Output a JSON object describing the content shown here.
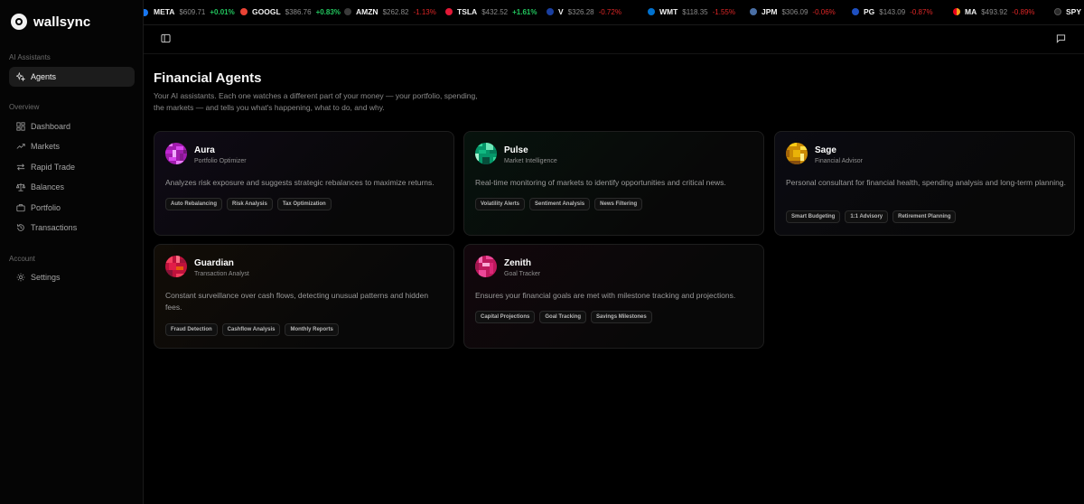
{
  "brand": {
    "name": "wallsync"
  },
  "sidebar": {
    "sections": [
      {
        "label": "AI Assistants"
      },
      {
        "label": "Overview"
      },
      {
        "label": "Account"
      }
    ],
    "items": [
      {
        "label": "Agents",
        "icon": "sparkles-icon",
        "active": true
      },
      {
        "label": "Dashboard",
        "icon": "grid-icon"
      },
      {
        "label": "Markets",
        "icon": "trending-icon"
      },
      {
        "label": "Rapid Trade",
        "icon": "arrows-icon"
      },
      {
        "label": "Balances",
        "icon": "scale-icon"
      },
      {
        "label": "Portfolio",
        "icon": "briefcase-icon"
      },
      {
        "label": "Transactions",
        "icon": "history-icon"
      },
      {
        "label": "Settings",
        "icon": "gear-icon"
      }
    ]
  },
  "ticker": [
    {
      "symbol": "META",
      "price": "$609.71",
      "change": "+0.01%",
      "dir": "up",
      "color": "#1877f2"
    },
    {
      "symbol": "GOOGL",
      "price": "$386.76",
      "change": "+0.83%",
      "dir": "up",
      "color": "#ea4335"
    },
    {
      "symbol": "AMZN",
      "price": "$262.82",
      "change": "-1.13%",
      "dir": "down",
      "color": "#333333"
    },
    {
      "symbol": "TSLA",
      "price": "$432.52",
      "change": "+1.61%",
      "dir": "up",
      "color": "#e31937"
    },
    {
      "symbol": "V",
      "price": "$326.28",
      "change": "-0.72%",
      "dir": "down",
      "color": "#1a1f71"
    },
    {
      "symbol": "WMT",
      "price": "$118.35",
      "change": "-1.55%",
      "dir": "down",
      "color": "#0071ce"
    },
    {
      "symbol": "JPM",
      "price": "$306.09",
      "change": "-0.06%",
      "dir": "down",
      "color": "#4a6fa5"
    },
    {
      "symbol": "PG",
      "price": "$143.09",
      "change": "-0.87%",
      "dir": "down",
      "color": "#003da5"
    },
    {
      "symbol": "MA",
      "price": "$493.92",
      "change": "-0.89%",
      "dir": "down",
      "color": "#eb001b"
    },
    {
      "symbol": "SPY",
      "price": "",
      "change": "",
      "dir": "up",
      "color": "#222222"
    }
  ],
  "topbar": {
    "left_icon": "sidebar-toggle-icon",
    "right_icon": "chat-icon"
  },
  "main": {
    "title": "Financial Agents",
    "description": "Your AI assistants. Each one watches a different part of your money — your portfolio, spending, the markets — and tells you what's happening, what to do, and why.",
    "agents": [
      {
        "name": "Aura",
        "role": "Portfolio Optimizer",
        "description": "Analyzes risk exposure and suggests strategic rebalances to maximize returns.",
        "tags": [
          "Auto Rebalancing",
          "Risk Analysis",
          "Tax Optimization"
        ],
        "accent": "#c026d3",
        "tint": "#0e0a14"
      },
      {
        "name": "Pulse",
        "role": "Market Intelligence",
        "description": "Real-time monitoring of markets to identify opportunities and critical news.",
        "tags": [
          "Volatility Alerts",
          "Sentiment Analysis",
          "News Filtering"
        ],
        "accent": "#10b981",
        "tint": "#07110c"
      },
      {
        "name": "Sage",
        "role": "Financial Advisor",
        "description": "Personal consultant for financial health, spending analysis and long-term planning.",
        "tags": [
          "Smart Budgeting",
          "1:1 Advisory",
          "Retirement Planning"
        ],
        "accent": "#eab308",
        "tint": "#0a0a10"
      },
      {
        "name": "Guardian",
        "role": "Transaction Analyst",
        "description": "Constant surveillance over cash flows, detecting unusual patterns and hidden fees.",
        "tags": [
          "Fraud Detection",
          "Cashflow Analysis",
          "Monthly Reports"
        ],
        "accent": "#e11d48",
        "tint": "#110c07"
      },
      {
        "name": "Zenith",
        "role": "Goal Tracker",
        "description": "Ensures your financial goals are met with milestone tracking and projections.",
        "tags": [
          "Capital Projections",
          "Goal Tracking",
          "Savings Milestones"
        ],
        "accent": "#db2777",
        "tint": "#10070b"
      }
    ]
  }
}
